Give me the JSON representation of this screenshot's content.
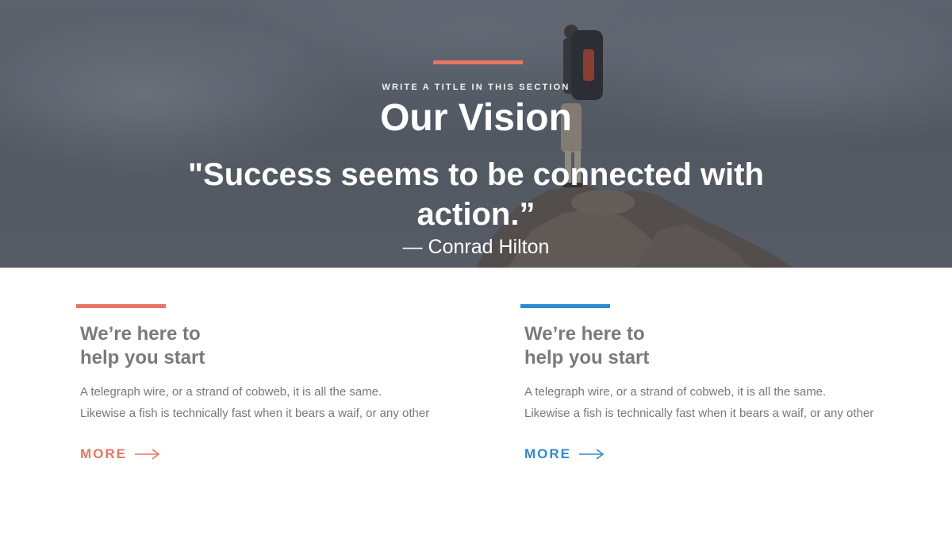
{
  "colors": {
    "accent_coral": "#e87563",
    "accent_blue": "#2f8ad2",
    "heading_gray": "#7a7a7a",
    "body_gray": "#777777"
  },
  "hero": {
    "kicker": "WRITE A TITLE IN THIS SECTION",
    "title": "Our Vision",
    "quote": "\"Success seems to be connected with action.”",
    "author": "— Conrad Hilton"
  },
  "cards": [
    {
      "heading_line1": "We’re here to",
      "heading_line2": "help you start",
      "text_line1": "A telegraph wire, or a strand of cobweb, it is all the same.",
      "text_line2": "Likewise a fish is technically fast when it bears a waif, or any other",
      "more_label": "MORE",
      "more_icon": "arrow-right-icon",
      "accent": "coral"
    },
    {
      "heading_line1": "We’re here to",
      "heading_line2": "help you start",
      "text_line1": "A telegraph wire, or a strand of cobweb, it is all the same.",
      "text_line2": "Likewise a fish is technically fast when it bears a waif, or any other",
      "more_label": "MORE",
      "more_icon": "arrow-right-icon",
      "accent": "blue"
    }
  ]
}
